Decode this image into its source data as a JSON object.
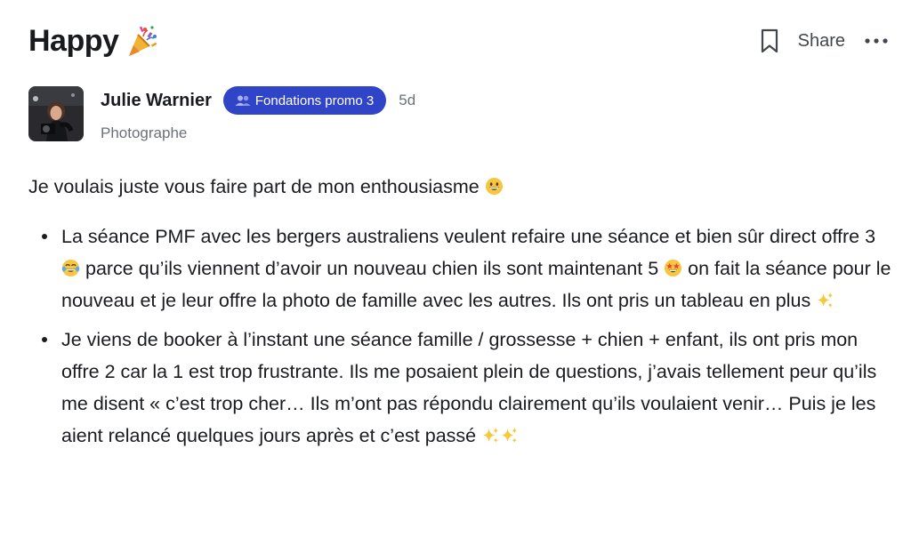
{
  "post": {
    "title": "Happy",
    "title_emoji": "party-popper-icon",
    "actions": {
      "bookmark_icon": "bookmark-icon",
      "share_label": "Share",
      "more_icon": "more-icon"
    }
  },
  "author": {
    "name": "Julie Warnier",
    "badge": "Fondations promo 3",
    "age": "5d",
    "role": "Photographe"
  },
  "content": {
    "intro": "Je voulais juste vous faire part de mon enthousiasme",
    "bullets": [
      {
        "parts": [
          "La séance PMF avec les bergers australiens veulent refaire une séance et bien sûr direct offre 3",
          "parce qu’ils viennent d’avoir un nouveau chien ils sont maintenant 5",
          "on fait la séance pour le nouveau et je leur offre la photo de famille avec les autres. Ils ont pris un tableau en plus"
        ]
      },
      {
        "parts": [
          "Je viens de booker à l’instant une séance famille / grossesse + chien + enfant, ils ont pris mon offre 2 car la 1 est trop frustrante. Ils me posaient plein de questions, j’avais tellement peur qu’ils me disent « c’est trop cher… Ils m’ont pas répondu clairement qu’ils voulaient venir… Puis je les aient relancé quelques jours après et c’est passé"
        ]
      }
    ]
  },
  "colors": {
    "text": "#191b1f",
    "muted": "#6b7079",
    "badge_bg": "#2f44c7",
    "badge_text": "#ffffff"
  }
}
